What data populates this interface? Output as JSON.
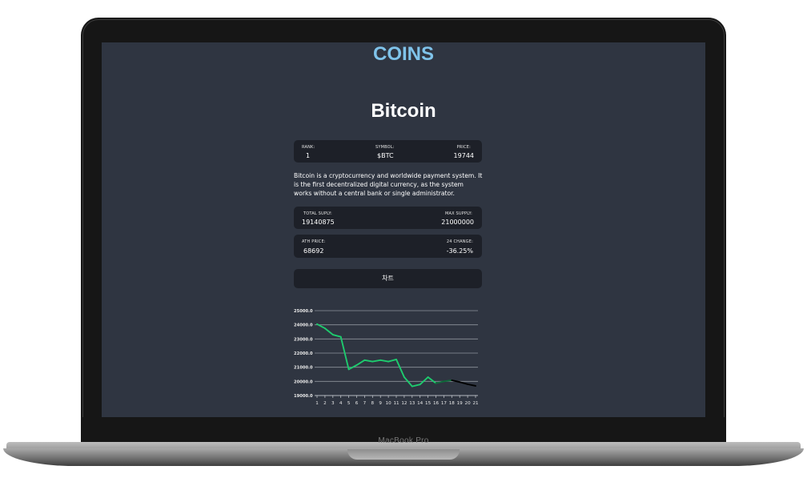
{
  "device": {
    "brand": "MacBook Pro"
  },
  "header": {
    "title": "COINS"
  },
  "coin": {
    "name": "Bitcoin",
    "overview": [
      {
        "label": "RANK:",
        "value": "1"
      },
      {
        "label": "SYMBOL:",
        "value": "$BTC"
      },
      {
        "label": "PRICE:",
        "value": "19744"
      }
    ],
    "description": "Bitcoin is a cryptocurrency and worldwide payment system. It is the first decentralized digital currency, as the system works without a central bank or single administrator.",
    "supply": [
      {
        "label": "TOTAL SUPLY:",
        "value": "19140875"
      },
      {
        "label": "MAX SUPPLY:",
        "value": "21000000"
      }
    ],
    "ath": [
      {
        "label": "ATH PRICE:",
        "value": "68692"
      },
      {
        "label": "24 CHANGE:",
        "value": "-36.25%"
      }
    ]
  },
  "chart_button": {
    "label": "차트"
  },
  "chart_data": {
    "type": "line",
    "x": [
      1,
      2,
      3,
      4,
      5,
      6,
      7,
      8,
      9,
      10,
      11,
      12,
      13,
      14,
      15,
      16,
      17,
      18,
      19,
      20,
      21
    ],
    "x_tick_labels": [
      "1",
      "2",
      "3",
      "4",
      "5",
      "6",
      "7",
      "8",
      "9",
      "10",
      "11",
      "12",
      "13",
      "14",
      "15",
      "16",
      "17",
      "18",
      "19",
      "20",
      "21"
    ],
    "y": [
      24050,
      23750,
      23300,
      23150,
      20850,
      21150,
      21500,
      21400,
      21500,
      21400,
      21550,
      20300,
      19650,
      19780,
      20300,
      19870,
      20000,
      20080,
      19950,
      19800,
      19680
    ],
    "y_tick_labels": [
      "25000.0",
      "24000.0",
      "23000.0",
      "22000.0",
      "21000.0",
      "20000.0",
      "19000.0"
    ],
    "ylim": [
      19000,
      25000
    ],
    "grid": true,
    "line_colors": {
      "up": "#1ecb6e",
      "down": "#000000"
    }
  }
}
